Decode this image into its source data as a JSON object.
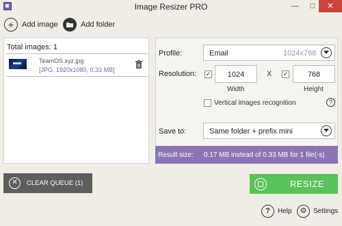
{
  "window": {
    "title": "Image Resizer PRO",
    "minimize_glyph": "—",
    "maximize_glyph": "□",
    "close_glyph": "✕"
  },
  "toolbar": {
    "add_image_label": "Add image",
    "add_folder_label": "Add folder"
  },
  "queue": {
    "total_label": "Total images: 1",
    "files": [
      {
        "name": "TeamOS.xyz.jpg",
        "info": "[JPG, 1920x1080, 0.33 MB]"
      }
    ]
  },
  "settings": {
    "profile_label": "Profile:",
    "profile_value": "Email",
    "profile_dimensions": "1024x768",
    "resolution_label": "Resolution:",
    "width_value": "1024",
    "height_value": "768",
    "x_separator": "X",
    "width_caption": "Width",
    "height_caption": "Height",
    "width_checked": true,
    "height_checked": true,
    "vertical_label": "Vertical images recognition",
    "vertical_checked": false,
    "save_to_label": "Save to:",
    "save_to_value": "Same folder + prefix mini",
    "result_label": "Result size:",
    "result_value": "0.17 MB instead of 0.33 MB for 1 file(-s)"
  },
  "actions": {
    "clear_queue_label": "CLEAR QUEUE (1)",
    "resize_label": "RESIZE",
    "help_label": "Help",
    "settings_label": "Settings"
  },
  "colors": {
    "accent_purple": "#8a76b5",
    "resize_green": "#5cc15a",
    "clear_gray": "#5e5e5e",
    "close_red": "#c9463d"
  },
  "icons": {
    "add_image": "plus-circle-icon",
    "add_folder": "folder-icon",
    "delete": "trash-icon",
    "clear": "close-circle-icon",
    "resize": "resize-icon",
    "help": "question-icon",
    "settings": "gear-icon"
  }
}
